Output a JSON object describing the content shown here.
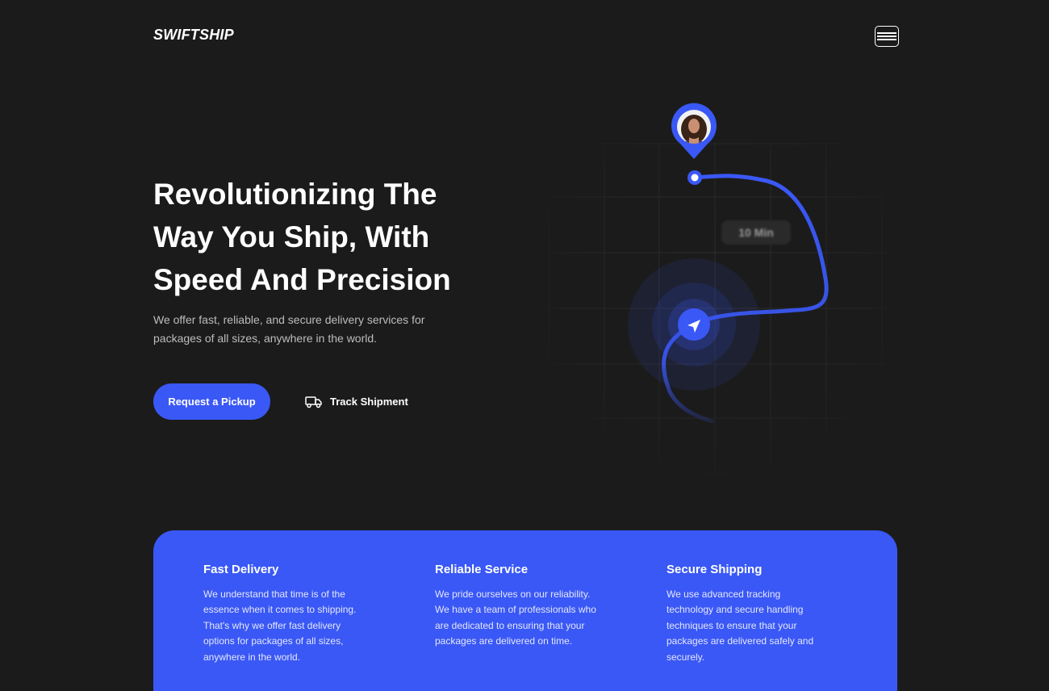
{
  "header": {
    "logo": "SWIFTSHIP",
    "menu_icon": "hamburger-menu-icon"
  },
  "hero": {
    "title_lines": [
      "Revolutionizing The",
      "Way You Ship, With",
      "Speed And Precision"
    ],
    "subtitle_lines": [
      "We offer fast, reliable, and secure delivery services for",
      "packages of all sizes, anywhere in the world."
    ],
    "primary_button": "Request a Pickup",
    "secondary_button": "Track Shipment",
    "secondary_icon": "truck-icon"
  },
  "map": {
    "time_badge": "10 Min",
    "accent_color": "#3a58f5",
    "pin_icon": "location-pin-avatar-icon",
    "navigation_icon": "navigation-arrow-icon"
  },
  "features": [
    {
      "title": "Fast Delivery",
      "description_lines": [
        "We understand that time is of the",
        "essence when it comes to shipping.",
        "That's why we offer fast delivery",
        "options for packages of all sizes,",
        "anywhere in the world."
      ]
    },
    {
      "title": "Reliable Service",
      "description_lines": [
        "We pride ourselves on our reliability.",
        "We have a team of professionals who",
        "are dedicated to ensuring that your",
        "packages are delivered on time."
      ]
    },
    {
      "title": "Secure Shipping",
      "description_lines": [
        "We use advanced tracking",
        "technology and secure handling",
        "techniques to ensure that your",
        "packages are delivered safely and",
        "securely."
      ]
    }
  ]
}
